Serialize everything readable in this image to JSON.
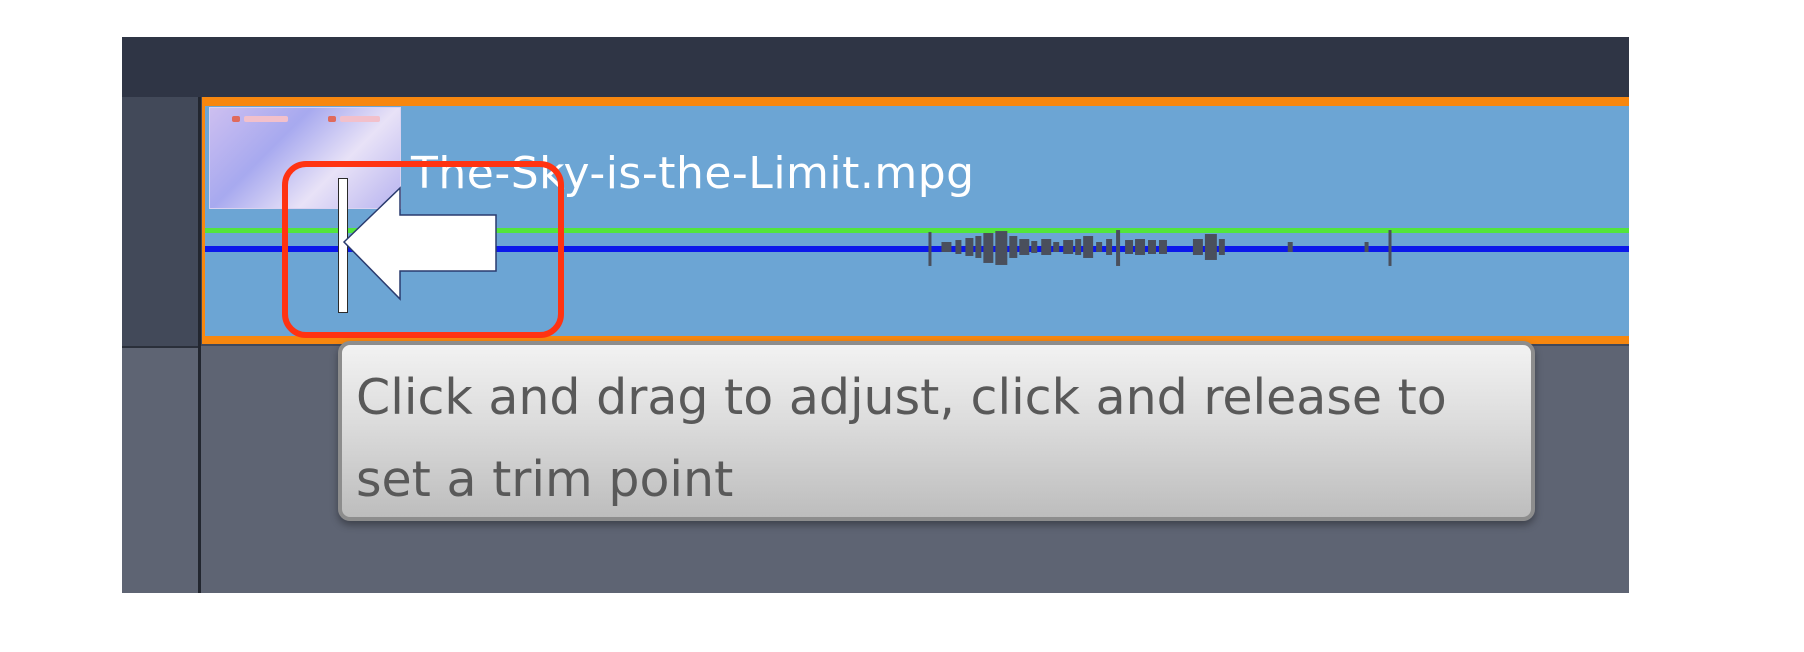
{
  "clip": {
    "filename": "The-Sky-is-the-Limit.mpg",
    "border_color": "#f7870f",
    "fill_color": "#6ca5d4"
  },
  "tooltip": {
    "text": "Click and drag to adjust, click and release to set a trim point"
  },
  "annotation": {
    "highlight_color": "#ff3312",
    "arrow_icon": "left-arrow-icon"
  },
  "lines": {
    "video_level_color": "#52e53c",
    "audio_level_color": "#0b18ea"
  }
}
